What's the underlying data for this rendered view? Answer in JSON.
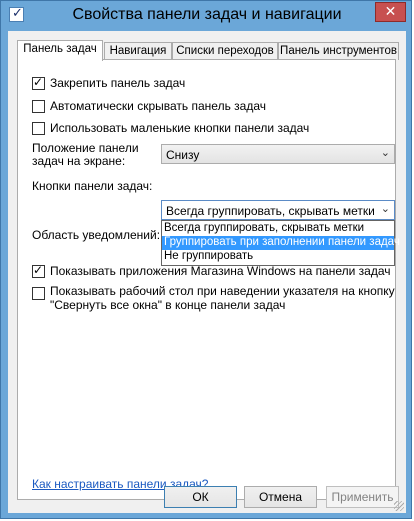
{
  "window": {
    "title": "Свойства панели задач и навигации",
    "close_symbol": "✕"
  },
  "tabs": [
    {
      "label": "Панель задач",
      "active": true
    },
    {
      "label": "Навигация",
      "active": false
    },
    {
      "label": "Списки переходов",
      "active": false
    },
    {
      "label": "Панель инструментов",
      "active": false
    }
  ],
  "options": {
    "lock_taskbar": {
      "label": "Закрепить панель задач",
      "checked": true
    },
    "auto_hide": {
      "label": "Автоматически скрывать панель задач",
      "checked": false
    },
    "small_buttons": {
      "label": "Использовать маленькие кнопки панели задач",
      "checked": false
    },
    "show_store_apps": {
      "label": "Показывать приложения Магазина Windows на панели задач",
      "checked": true
    },
    "peek_desktop": {
      "label_line1": "Показывать рабочий стол при наведении указателя на кнопку",
      "label_line2": "\"Свернуть все окна\" в конце панели задач",
      "checked": false
    }
  },
  "position": {
    "label_line1": "Положение панели",
    "label_line2": "задач на экране:",
    "value": "Снизу"
  },
  "buttons_combo": {
    "label": "Кнопки панели задач:",
    "value": "Всегда группировать, скрывать метки",
    "items": [
      "Всегда группировать, скрывать метки",
      "Группировать при заполнении панели задач",
      "Не группировать"
    ],
    "highlighted_index": 1
  },
  "notification_area": {
    "label": "Область уведомлений:"
  },
  "help_link": "Как настраивать панели задач?",
  "footer": {
    "ok": "ОК",
    "cancel": "Отмена",
    "apply": "Применить"
  },
  "icons": {
    "check": "✓",
    "chevron": "⌄"
  }
}
